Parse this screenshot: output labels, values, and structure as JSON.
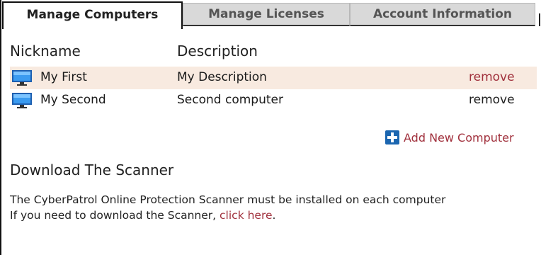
{
  "tabs": [
    {
      "label": "Manage Computers",
      "active": true
    },
    {
      "label": "Manage Licenses",
      "active": false
    },
    {
      "label": "Account Information",
      "active": false
    }
  ],
  "table": {
    "headers": {
      "nickname": "Nickname",
      "description": "Description"
    },
    "rows": [
      {
        "icon": "computer-monitor-icon",
        "nickname": "My First",
        "description": "My Description",
        "action": "remove",
        "highlighted": true
      },
      {
        "icon": "computer-monitor-icon",
        "nickname": "My Second",
        "description": "Second computer",
        "action": "remove",
        "highlighted": false
      }
    ]
  },
  "add_computer": {
    "icon": "plus-icon",
    "label": "Add New Computer"
  },
  "download": {
    "title": "Download The Scanner",
    "line1": "The CyberPatrol Online Protection Scanner must be installed on each computer",
    "line2_prefix": "If you need to download the Scanner, ",
    "link_text": "click here",
    "line2_suffix": "."
  },
  "colors": {
    "accent_link": "#a1313d",
    "row_highlight": "#f8eae0",
    "plus_icon": "#1b66b0",
    "tab_inactive_bg": "#d9d9d9"
  }
}
